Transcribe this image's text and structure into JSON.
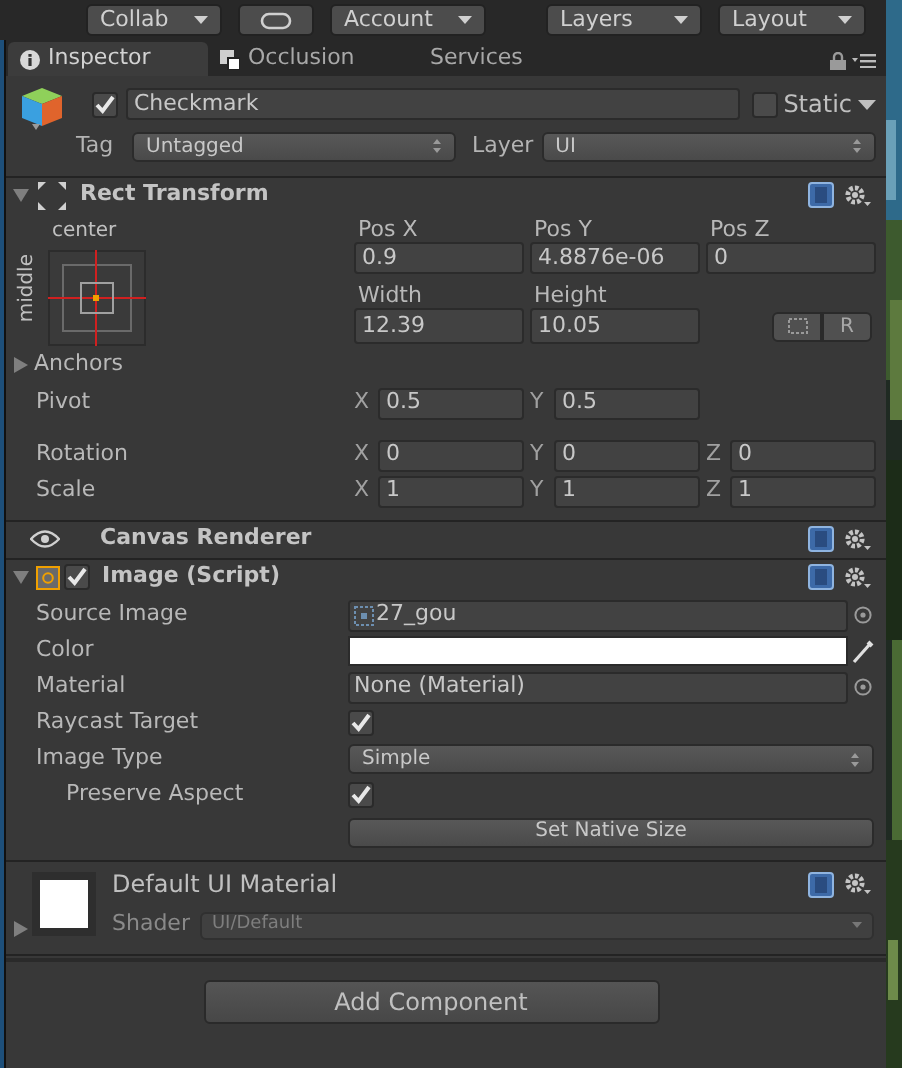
{
  "toolbar": [
    {
      "label": "Collab",
      "kind": "dropdown"
    },
    {
      "kind": "cloud"
    },
    {
      "label": "Account",
      "kind": "dropdown"
    },
    {
      "label": "Layers",
      "kind": "dropdown"
    },
    {
      "label": "Layout",
      "kind": "dropdown"
    }
  ],
  "tabs": [
    {
      "label": "Inspector",
      "selected": true,
      "kind": "info"
    },
    {
      "label": "Occlusion",
      "selected": false,
      "kind": "occlusion"
    },
    {
      "label": "Services",
      "selected": false,
      "kind": "plain"
    }
  ],
  "object": {
    "active": true,
    "name": "Checkmark",
    "static": false,
    "static_label": "Static",
    "tag_label": "Tag",
    "tag": "Untagged",
    "layer_label": "Layer",
    "layer": "UI"
  },
  "rect_transform": {
    "title": "Rect Transform",
    "expanded": true,
    "anchor_horizontal": "center",
    "anchor_vertical": "middle",
    "position": [
      {
        "label": "Pos X",
        "value": "0.9"
      },
      {
        "label": "Pos Y",
        "value": "4.8876e-06"
      },
      {
        "label": "Pos Z",
        "value": "0"
      }
    ],
    "size": [
      {
        "label": "Width",
        "value": "12.39"
      },
      {
        "label": "Height",
        "value": "10.05"
      }
    ],
    "raw_button": "R",
    "anchors": {
      "label": "Anchors",
      "expanded": false
    },
    "vectors": [
      {
        "label": "Pivot",
        "axes": [
          {
            "axis": "X",
            "value": "0.5"
          },
          {
            "axis": "Y",
            "value": "0.5"
          }
        ]
      },
      {
        "label": "Rotation",
        "axes": [
          {
            "axis": "X",
            "value": "0"
          },
          {
            "axis": "Y",
            "value": "0"
          },
          {
            "axis": "Z",
            "value": "0"
          }
        ]
      },
      {
        "label": "Scale",
        "axes": [
          {
            "axis": "X",
            "value": "1"
          },
          {
            "axis": "Y",
            "value": "1"
          },
          {
            "axis": "Z",
            "value": "1"
          }
        ]
      }
    ]
  },
  "canvas_renderer": {
    "title": "Canvas Renderer"
  },
  "image": {
    "title": "Image (Script)",
    "enabled": true,
    "expanded": true,
    "properties": [
      {
        "kind": "sprite",
        "label": "Source Image",
        "value": "27_gou"
      },
      {
        "kind": "color",
        "label": "Color",
        "color": "#ffffff"
      },
      {
        "kind": "object",
        "label": "Material",
        "value": "None (Material)"
      },
      {
        "kind": "toggle",
        "label": "Raycast Target",
        "checked": true
      },
      {
        "kind": "dropdown",
        "label": "Image Type",
        "value": "Simple",
        "children": [
          {
            "kind": "toggle",
            "label": "Preserve Aspect",
            "checked": true
          }
        ]
      }
    ],
    "button": "Set Native Size"
  },
  "material": {
    "name": "Default UI Material",
    "shader_label": "Shader",
    "shader": "UI/Default",
    "expanded": false
  },
  "add_component": "Add Component"
}
